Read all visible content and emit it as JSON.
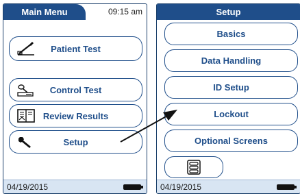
{
  "left_screen": {
    "title": "Main Menu",
    "time": "09:15 am",
    "buttons": {
      "patient_test": "Patient Test",
      "control_test": "Control Test",
      "review_results": "Review Results",
      "setup": "Setup"
    },
    "status": {
      "date": "04/19/2015"
    }
  },
  "right_screen": {
    "title": "Setup",
    "buttons": {
      "basics": "Basics",
      "data_handling": "Data Handling",
      "id_setup": "ID Setup",
      "lockout": "Lockout",
      "optional_screens": "Optional Screens"
    },
    "status": {
      "date": "04/19/2015"
    }
  },
  "colors": {
    "accent": "#1f4e8a",
    "status_bar": "#d8e5f3"
  },
  "icons": [
    "meter-strip-icon",
    "control-meter-icon",
    "book-results-icon",
    "wrench-icon",
    "list-menu-icon",
    "battery-icon",
    "pointer-arrow-icon"
  ]
}
